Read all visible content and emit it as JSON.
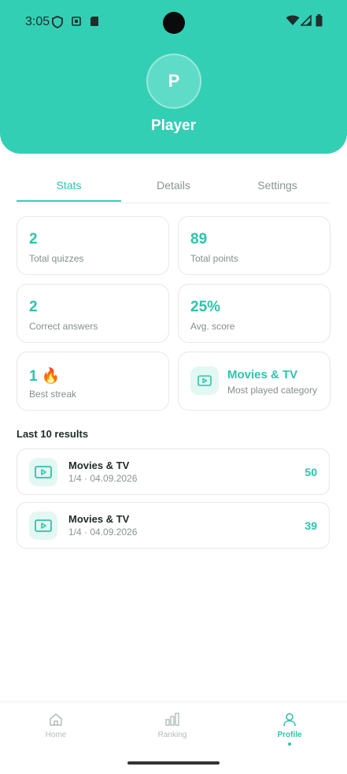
{
  "status_bar": {
    "time": "3:05"
  },
  "profile": {
    "avatar_letter": "P",
    "name": "Player"
  },
  "tabs": [
    {
      "label": "Stats",
      "active": true
    },
    {
      "label": "Details",
      "active": false
    },
    {
      "label": "Settings",
      "active": false
    }
  ],
  "stats": {
    "total_quizzes": {
      "value": "2",
      "label": "Total quizzes"
    },
    "total_points": {
      "value": "89",
      "label": "Total points"
    },
    "correct_answers": {
      "value": "2",
      "label": "Correct answers"
    },
    "avg_score": {
      "value": "25%",
      "label": "Avg. score"
    },
    "best_streak": {
      "value": "1 🔥",
      "label": "Best streak"
    },
    "category": {
      "value": "Movies & TV",
      "label": "Most played category",
      "icon": "tv-icon"
    }
  },
  "results": {
    "title": "Last 10 results",
    "items": [
      {
        "category": "Movies & TV",
        "meta": "1/4 · 04.09.2026",
        "score": "50",
        "icon": "tv-icon"
      },
      {
        "category": "Movies & TV",
        "meta": "1/4 · 04.09.2026",
        "score": "39",
        "icon": "tv-icon"
      }
    ]
  },
  "nav": [
    {
      "label": "Home",
      "icon": "home-icon",
      "active": false
    },
    {
      "label": "Ranking",
      "icon": "bar-chart-icon",
      "active": false
    },
    {
      "label": "Profile",
      "icon": "user-icon",
      "active": true
    }
  ],
  "colors": {
    "accent": "#33cfb5",
    "accent_text": "#2cc4aa"
  }
}
